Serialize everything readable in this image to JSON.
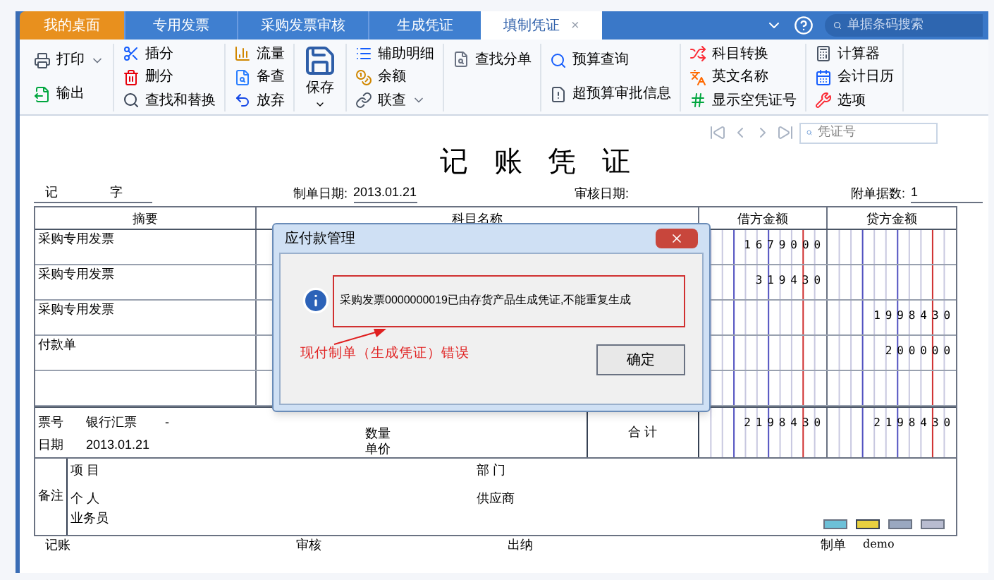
{
  "tabs": [
    {
      "label": "我的桌面",
      "kind": "home",
      "selected": false
    },
    {
      "label": "专用发票",
      "kind": "normal",
      "selected": false
    },
    {
      "label": "采购发票审核",
      "kind": "normal",
      "selected": false
    },
    {
      "label": "生成凭证",
      "kind": "normal",
      "selected": false
    },
    {
      "label": "填制凭证",
      "kind": "normal",
      "selected": true,
      "close": "×"
    }
  ],
  "header_search": {
    "placeholder": "单据条码搜索"
  },
  "toolbar": {
    "groups": [
      [
        {
          "label": "打印",
          "caret": true
        },
        {
          "label": "输出"
        }
      ],
      [
        {
          "label": "插分"
        },
        {
          "label": "删分"
        },
        {
          "label": "查找和替换"
        }
      ],
      [
        {
          "label": "流量"
        },
        {
          "label": "备查"
        },
        {
          "label": "放弃"
        }
      ],
      [
        {
          "label": "保存",
          "kind": "big",
          "caret": true
        }
      ],
      [
        {
          "label": "辅助明细"
        },
        {
          "label": "余额"
        },
        {
          "label": "联查",
          "caret": true
        }
      ],
      [
        {
          "label": "查找分单"
        }
      ],
      [
        {
          "label": "预算查询"
        },
        {
          "label": "超预算审批信息"
        }
      ],
      [
        {
          "label": "科目转换"
        },
        {
          "label": "英文名称"
        },
        {
          "label": "显示空凭证号"
        }
      ],
      [
        {
          "label": "计算器"
        },
        {
          "label": "会计日历"
        },
        {
          "label": "选项"
        }
      ]
    ]
  },
  "nav_search": {
    "placeholder": "凭证号"
  },
  "voucher": {
    "title": "记 账 凭 证",
    "type_label": "记",
    "word": "字",
    "made_date_label": "制单日期:",
    "made_date": "2013.01.21",
    "audit_date_label": "审核日期:",
    "attachments_label": "附单据数:",
    "attachments": "1"
  },
  "table": {
    "columns": [
      "摘要",
      "科目名称",
      "借方金额",
      "贷方金额"
    ],
    "rows": [
      {
        "summary": "采购专用发票",
        "debit": "1679000"
      },
      {
        "summary": "采购专用发票",
        "debit": "319430"
      },
      {
        "summary": "采购专用发票",
        "credit": "1998430"
      },
      {
        "summary": "付款单",
        "credit": "200000"
      }
    ]
  },
  "bottom": {
    "ticket_label": "票号",
    "ticket_value": "银行汇票",
    "ticket_dash": "-",
    "date_label": "日期",
    "date_value": "2013.01.21",
    "qty_label": "数量",
    "price_label": "单价",
    "total_label": "合 计",
    "total_debit": "2198430",
    "total_credit": "2198430"
  },
  "remarks": {
    "label": "备注",
    "left": [
      "项 目",
      "个 人",
      "业务员"
    ],
    "right": [
      "部 门",
      "供应商"
    ]
  },
  "footer": [
    {
      "label": "记账"
    },
    {
      "label": "审核"
    },
    {
      "label": "出纳"
    },
    {
      "label": "制单",
      "value": "demo"
    }
  ],
  "dialog": {
    "title": "应付款管理",
    "message": "采购发票0000000019已由存货产品生成凭证,不能重复生成",
    "annotation": "现付制单（生成凭证）错误",
    "button": "确定"
  }
}
